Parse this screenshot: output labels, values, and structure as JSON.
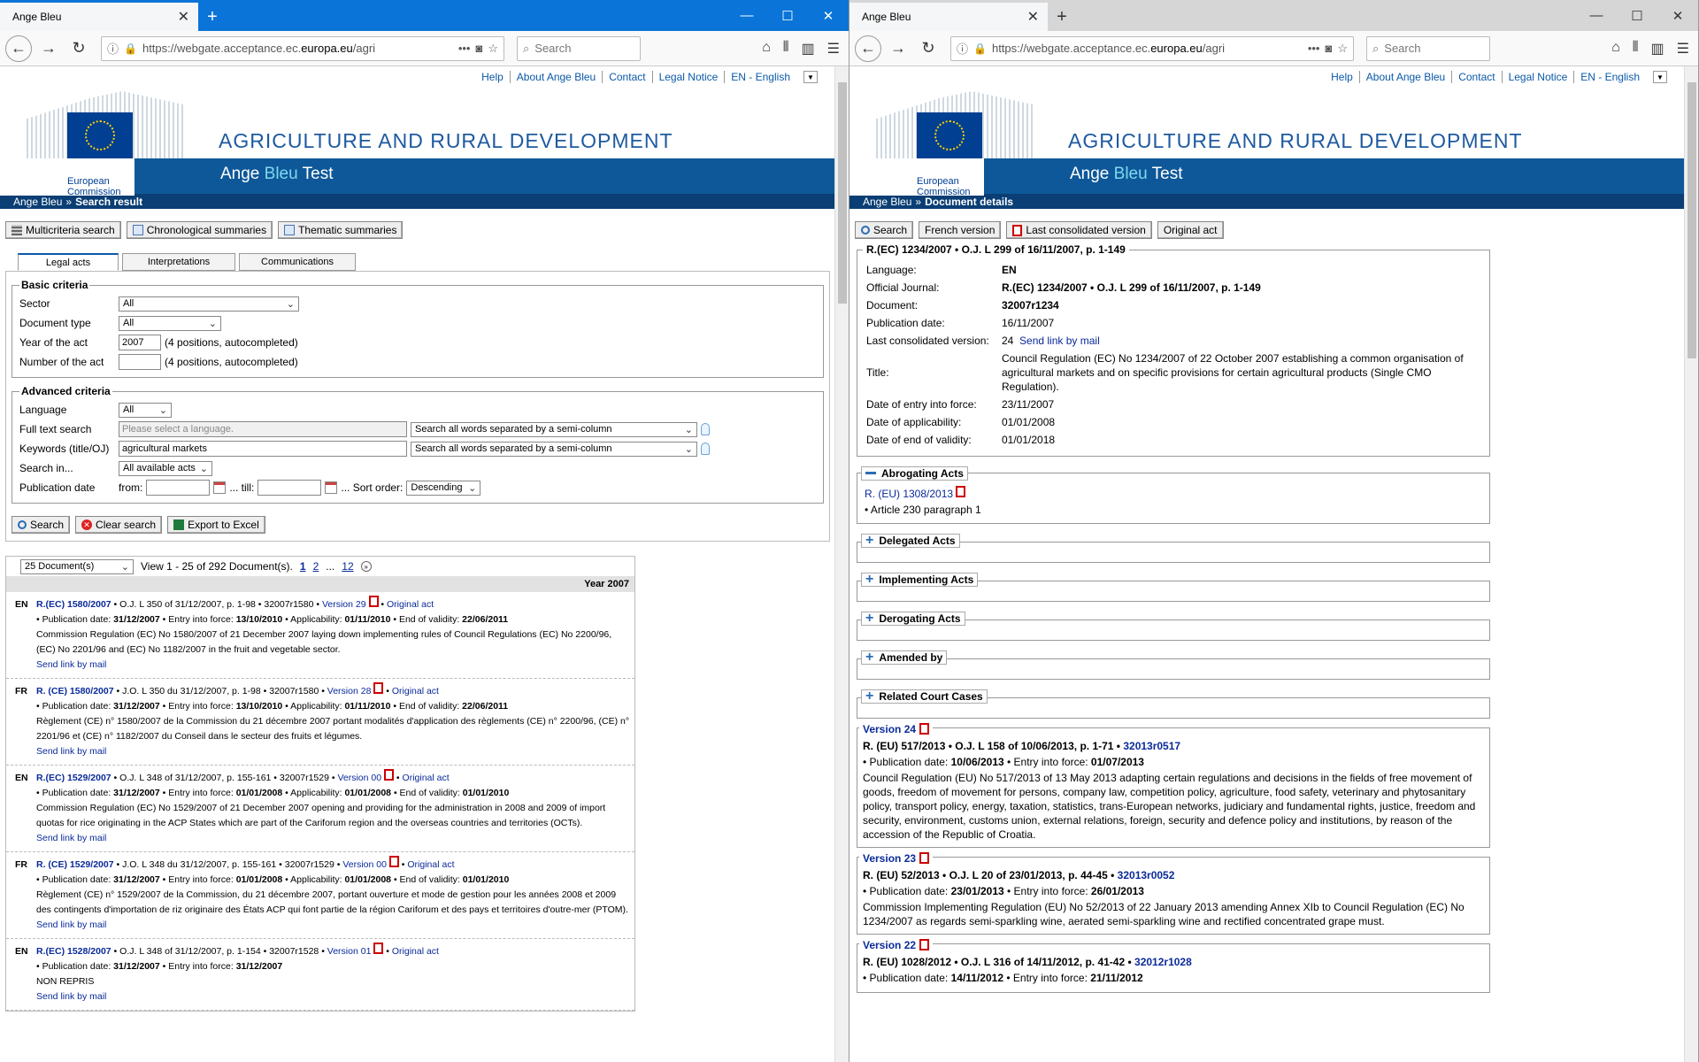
{
  "left": {
    "tab_title": "Ange Bleu",
    "url_prefix": "https://webgate.acceptance.ec.",
    "url_domain": "europa.eu",
    "url_suffix": "/agri",
    "search_placeholder": "Search",
    "toplinks": [
      "Help",
      "About Ange Bleu",
      "Contact",
      "Legal Notice",
      "EN - English"
    ],
    "ec_line1": "European",
    "ec_line2": "Commission",
    "site_title": "AGRICULTURE AND RURAL DEVELOPMENT",
    "subtitle_a": "Ange ",
    "subtitle_b": "Bleu",
    "subtitle_c": " Test",
    "breadcrumb_home": "Ange Bleu",
    "breadcrumb_sep": "»",
    "breadcrumb_current": "Search result",
    "buttons": [
      "Multicriteria search",
      "Chronological summaries",
      "Thematic summaries"
    ],
    "tabs": [
      "Legal acts",
      "Interpretations",
      "Communications"
    ],
    "basic": {
      "legend": "Basic criteria",
      "sector_label": "Sector",
      "sector_value": "All",
      "doctype_label": "Document type",
      "doctype_value": "All",
      "year_label": "Year of the act",
      "year_value": "2007",
      "year_hint": "(4 positions, autocompleted)",
      "number_label": "Number of the act",
      "number_value": "",
      "number_hint": "(4 positions, autocompleted)"
    },
    "advanced": {
      "legend": "Advanced criteria",
      "language_label": "Language",
      "language_value": "All",
      "fulltext_label": "Full text search",
      "fulltext_placeholder": "Please select a language.",
      "fulltext_mode": "Search all words separated by a semi-column",
      "keywords_label": "Keywords (title/OJ)",
      "keywords_value": "agricultural markets",
      "keywords_mode": "Search all words separated by a semi-column",
      "searchin_label": "Search in...",
      "searchin_value": "All available acts",
      "pubdate_label": "Publication date",
      "from_label": "from:",
      "till_label": "... till:",
      "sort_label": "... Sort order:",
      "sort_value": "Descending"
    },
    "actions": [
      "Search",
      "Clear search",
      "Export to Excel"
    ],
    "results": {
      "perpage": "25 Document(s)",
      "view": "View 1 - 25 of 292 Document(s).",
      "pages": [
        "1",
        "2",
        "...",
        "12"
      ],
      "year": "Year 2007",
      "items": [
        {
          "lang": "EN",
          "ref": "R.(EC) 1580/2007",
          "oj": " • O.J. L 350 of 31/12/2007, p. 1-98 • 32007r1580 • ",
          "version": "Version 29",
          "original": "Original act",
          "meta1": "• Publication date: ",
          "pub": "31/12/2007",
          "meta2": " • Entry into force: ",
          "force": "13/10/2010",
          "meta3": " • Applicability: ",
          "appl": "01/11/2010",
          "meta4": " • End of validity: ",
          "end": "22/06/2011",
          "title": "Commission Regulation (EC) No 1580/2007 of 21 December 2007 laying down implementing rules of Council Regulations (EC) No 2200/96, (EC) No 2201/96 and (EC) No 1182/2007 in the fruit and vegetable sector.",
          "mail": "Send link by mail"
        },
        {
          "lang": "FR",
          "ref": "R. (CE) 1580/2007",
          "oj": " • J.O. L 350 du 31/12/2007, p. 1-98 • 32007r1580 • ",
          "version": "Version 28",
          "original": "Original act",
          "meta1": "• Publication date: ",
          "pub": "31/12/2007",
          "meta2": " • Entry into force: ",
          "force": "13/10/2010",
          "meta3": " • Applicability: ",
          "appl": "01/11/2010",
          "meta4": " • End of validity: ",
          "end": "22/06/2011",
          "title": "Règlement (CE) n° 1580/2007 de la Commission du 21 décembre 2007 portant modalités d'application des règlements (CE) n° 2200/96, (CE) n° 2201/96 et (CE) n° 1182/2007 du Conseil dans le secteur des fruits et légumes.",
          "mail": "Send link by mail"
        },
        {
          "lang": "EN",
          "ref": "R.(EC) 1529/2007",
          "oj": " • O.J. L 348 of 31/12/2007, p. 155-161 • 32007r1529 • ",
          "version": "Version 00",
          "original": "Original act",
          "meta1": "• Publication date: ",
          "pub": "31/12/2007",
          "meta2": " • Entry into force: ",
          "force": "01/01/2008",
          "meta3": " • Applicability: ",
          "appl": "01/01/2008",
          "meta4": " • End of validity: ",
          "end": "01/01/2010",
          "title": "Commission Regulation (EC) No 1529/2007 of 21 December 2007 opening and providing for the administration in 2008 and 2009 of import quotas for rice originating in the ACP States which are part of the Cariforum region and the overseas countries and territories (OCTs).",
          "mail": "Send link by mail"
        },
        {
          "lang": "FR",
          "ref": "R. (CE) 1529/2007",
          "oj": " • J.O. L 348 du 31/12/2007, p. 155-161 • 32007r1529 • ",
          "version": "Version 00",
          "original": "Original act",
          "meta1": "• Publication date: ",
          "pub": "31/12/2007",
          "meta2": " • Entry into force: ",
          "force": "01/01/2008",
          "meta3": " • Applicability: ",
          "appl": "01/01/2008",
          "meta4": " • End of validity: ",
          "end": "01/01/2010",
          "title": "Règlement (CE) n° 1529/2007 de la Commission, du 21 décembre 2007, portant ouverture et mode de gestion pour les années 2008 et 2009 des contingents d'importation de riz originaire des États ACP qui font partie de la région Cariforum et des pays et territoires d'outre-mer (PTOM).",
          "mail": "Send link by mail"
        },
        {
          "lang": "EN",
          "ref": "R.(EC) 1528/2007",
          "oj": " • O.J. L 348 of 31/12/2007, p. 1-154 • 32007r1528 • ",
          "version": "Version 01",
          "original": "Original act",
          "meta1": "• Publication date: ",
          "pub": "31/12/2007",
          "meta2": " • Entry into force: ",
          "force": "31/12/2007",
          "meta3": "",
          "appl": "",
          "meta4": "",
          "end": "",
          "title": "NON REPRIS",
          "mail": "Send link by mail"
        }
      ]
    }
  },
  "right": {
    "tab_title": "Ange Bleu",
    "url_prefix": "https://webgate.acceptance.ec.",
    "url_domain": "europa.eu",
    "url_suffix": "/agri",
    "search_placeholder": "Search",
    "toplinks": [
      "Help",
      "About Ange Bleu",
      "Contact",
      "Legal Notice",
      "EN - English"
    ],
    "ec_line1": "European",
    "ec_line2": "Commission",
    "site_title": "AGRICULTURE AND RURAL DEVELOPMENT",
    "subtitle_a": "Ange ",
    "subtitle_b": "Bleu",
    "subtitle_c": " Test",
    "breadcrumb_home": "Ange Bleu",
    "breadcrumb_sep": "»",
    "breadcrumb_current": "Document details",
    "buttons": [
      "Search",
      "French version",
      "Last consolidated version",
      "Original act"
    ],
    "doc": {
      "legend": "R.(EC) 1234/2007 • O.J. L 299 of 16/11/2007, p. 1-149",
      "rows": [
        {
          "k": "Language:",
          "v": "EN",
          "bold": true
        },
        {
          "k": "Official Journal:",
          "v": "R.(EC) 1234/2007 • O.J. L 299 of 16/11/2007, p. 1-149",
          "bold": true
        },
        {
          "k": "Document:",
          "v": "32007r1234",
          "bold": true
        },
        {
          "k": "Publication date:",
          "v": "16/11/2007",
          "bold": false
        }
      ],
      "last_label": "Last consolidated version:",
      "last_value": "24",
      "last_link": "Send link by mail",
      "title_label": "Title:",
      "title_value": "Council Regulation (EC) No 1234/2007 of 22 October 2007 establishing a common organisation of agricultural markets and on specific provisions for certain agricultural products (Single CMO Regulation).",
      "rows2": [
        {
          "k": "Date of entry into force:",
          "v": "23/11/2007"
        },
        {
          "k": "Date of applicability:",
          "v": "01/01/2008"
        },
        {
          "k": "Date of end of validity:",
          "v": "01/01/2018"
        }
      ]
    },
    "abrogating": {
      "label": "Abrogating Acts",
      "link": "R. (EU) 1308/2013",
      "article": "• Article 230 paragraph 1"
    },
    "sections": [
      "Delegated Acts",
      "Implementing Acts",
      "Derogating Acts",
      "Amended by",
      "Related Court Cases"
    ],
    "versions": [
      {
        "label": "Version 24",
        "head": "R. (EU) 517/2013 • O.J. L 158 of 10/06/2013, p. 1-71 • ",
        "celex": "32013r0517",
        "pubpre": "• Publication date: ",
        "pub": "10/06/2013",
        "forcepre": " • Entry into force: ",
        "force": "01/07/2013",
        "text": "Council Regulation (EU) No 517/2013 of 13 May 2013 adapting certain regulations and decisions in the fields of free movement of goods, freedom of movement for persons, company law, competition policy, agriculture, food safety, veterinary and phytosanitary policy, transport policy, energy, taxation, statistics, trans-European networks, judiciary and fundamental rights, justice, freedom and security, environment, customs union, external relations, foreign, security and defence policy and institutions, by reason of the accession of the Republic of Croatia."
      },
      {
        "label": "Version 23",
        "head": "R. (EU) 52/2013 • O.J. L 20 of 23/01/2013, p. 44-45 • ",
        "celex": "32013r0052",
        "pubpre": "• Publication date: ",
        "pub": "23/01/2013",
        "forcepre": " • Entry into force: ",
        "force": "26/01/2013",
        "text": "Commission Implementing Regulation (EU) No 52/2013 of 22 January 2013 amending Annex XIb to Council Regulation (EC) No 1234/2007 as regards semi-sparkling wine, aerated semi-sparkling wine and rectified concentrated grape must."
      },
      {
        "label": "Version 22",
        "head": "R. (EU) 1028/2012 • O.J. L 316 of 14/11/2012, p. 41-42 • ",
        "celex": "32012r1028",
        "pubpre": "• Publication date: ",
        "pub": "14/11/2012",
        "forcepre": " • Entry into force: ",
        "force": "21/11/2012",
        "text": ""
      }
    ]
  }
}
